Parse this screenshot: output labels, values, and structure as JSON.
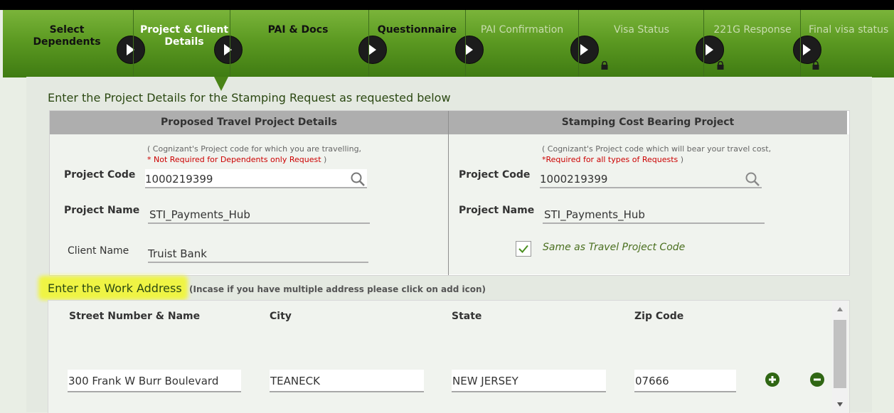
{
  "steps": [
    {
      "label": "Select Dependents",
      "state": "done"
    },
    {
      "label": "Project & Client Details",
      "state": "active"
    },
    {
      "label": "PAI & Docs",
      "state": "done"
    },
    {
      "label": "Questionnaire",
      "state": "done"
    },
    {
      "label": "PAI Confirmation",
      "state": "future"
    },
    {
      "label": "Visa Status",
      "state": "locked"
    },
    {
      "label": "221G Response",
      "state": "locked"
    },
    {
      "label": "Final visa status",
      "state": "locked"
    }
  ],
  "project": {
    "heading": "Enter the Project Details for the Stamping Request as requested below",
    "travel": {
      "title": "Proposed Travel Project Details",
      "note_line1": "( Cognizant's Project code for which you are travelling,",
      "note_required": "* Not Required for Dependents only Request",
      "note_close": " )",
      "code_label": "Project Code",
      "code_value": "1000219399",
      "name_label": "Project Name",
      "name_value": "STI_Payments_Hub",
      "client_label": "Client Name",
      "client_value": "Truist Bank"
    },
    "cost": {
      "title": "Stamping Cost Bearing Project",
      "note_line1": "( Cognizant's Project code which will bear your travel cost,",
      "note_required": "*Required for all types of Requests",
      "note_close": " )",
      "code_label": "Project Code",
      "code_value": "1000219399",
      "name_label": "Project Name",
      "name_value": "STI_Payments_Hub",
      "same_as_label": "Same as Travel Project Code",
      "same_as_checked": true
    }
  },
  "work_address": {
    "title": "Enter the Work Address",
    "note": "(Incase if you have multiple address please click on add icon)",
    "headers": {
      "street": "Street Number & Name",
      "city": "City",
      "state": "State",
      "zip": "Zip Code"
    },
    "row": {
      "street": "300 Frank W Burr Boulevard",
      "city": "TEANECK",
      "state": "NEW JERSEY",
      "zip": "07666"
    }
  },
  "icons": {
    "step": "chevron-right-icon",
    "lock": "lock-icon",
    "search": "search-icon",
    "check": "check-icon",
    "add": "plus-circle-icon",
    "remove": "minus-circle-icon"
  },
  "colors": {
    "stepbar": "#5c9a22",
    "heading": "#2b4812",
    "required": "#cc0000",
    "highlight": "#f0f53c",
    "check": "#4a8f1f"
  }
}
